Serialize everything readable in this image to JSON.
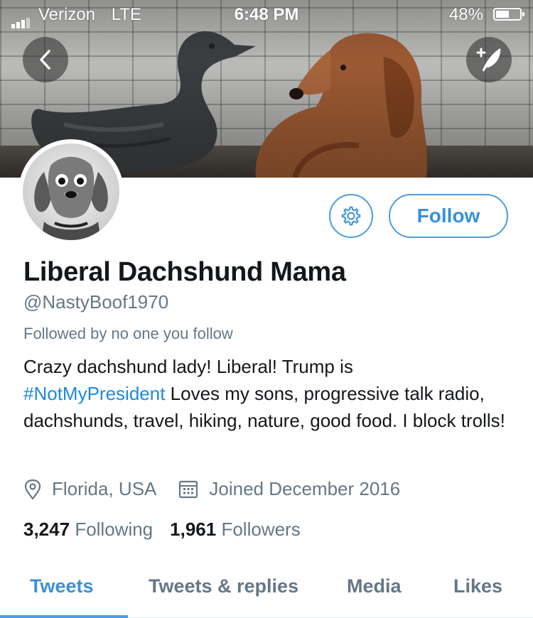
{
  "status_bar": {
    "carrier": "Verizon",
    "network": "LTE",
    "time": "6:48 PM",
    "battery": "48%"
  },
  "profile": {
    "name": "Liberal Dachshund Mama",
    "handle": "@NastyBoof1970",
    "followed_by": "Followed by no one you follow",
    "bio": {
      "line1": "Crazy dachshund lady! Liberal! Trump is",
      "hashtag": "#NotMyPresident",
      "rest": " Loves my sons, progressive talk radio, dachshunds, travel, hiking, nature, good food. I block trolls!"
    },
    "location": "Florida, USA",
    "joined": "Joined December 2016",
    "following_count": "3,247",
    "following_label": "Following",
    "followers_count": "1,961",
    "followers_label": "Followers"
  },
  "actions": {
    "follow_label": "Follow"
  },
  "tabs": [
    {
      "label": "Tweets",
      "active": true
    },
    {
      "label": "Tweets & replies",
      "active": false
    },
    {
      "label": "Media",
      "active": false
    },
    {
      "label": "Likes",
      "active": false
    }
  ],
  "colors": {
    "accent": "#4a9de0",
    "hashtag": "#1d8ae0",
    "secondary_text": "#657786"
  },
  "icons": {
    "back": "chevron-left-icon",
    "compose": "compose-feather-icon",
    "settings": "gear-icon",
    "location": "location-pin-icon",
    "calendar": "calendar-icon"
  }
}
